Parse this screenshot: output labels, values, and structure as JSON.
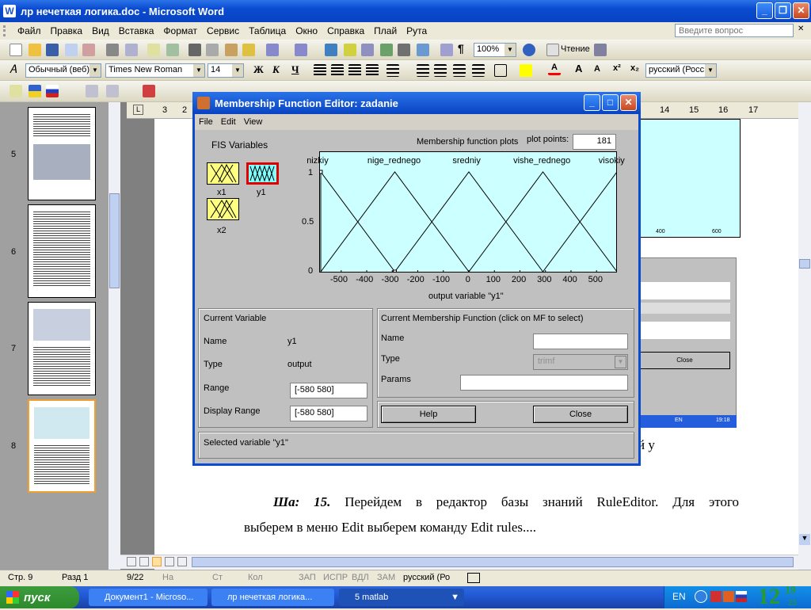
{
  "window": {
    "title": "лр нечеткая логика.doc - Microsoft Word",
    "app_icon": "W"
  },
  "menu": [
    "Файл",
    "Правка",
    "Вид",
    "Вставка",
    "Формат",
    "Сервис",
    "Таблица",
    "Окно",
    "Справка",
    "Плай",
    "Рута"
  ],
  "help_placeholder": "Введите вопрос",
  "toolbar": {
    "zoom": "100%",
    "read_label": "Чтение"
  },
  "format": {
    "style": "Обычный (веб)",
    "font": "Times New Roman",
    "size": "14",
    "bold": "Ж",
    "italic": "К",
    "underline": "Ч",
    "language": "русский (Росс"
  },
  "ruler": {
    "numbers": [
      "3",
      "2",
      "14",
      "15",
      "16",
      "17"
    ]
  },
  "thumbnails": [
    {
      "num": "5"
    },
    {
      "num": "6"
    },
    {
      "num": "7"
    },
    {
      "num": "8"
    }
  ],
  "document": {
    "partial_line": "й у",
    "step_label": "Ша: 15.",
    "step_text": "Перейдем в редактор базы знаний RuleEditor. Для этого",
    "step_text2": "выберем в меню Edit выберем команду Edit rules....",
    "bg_ticks": [
      "400",
      "600"
    ],
    "bg_close": "Close",
    "bg_tray_lang": "EN",
    "bg_tray_time": "19:18"
  },
  "dialog": {
    "title": "Membership Function Editor: zadanie",
    "menu": [
      "File",
      "Edit",
      "View"
    ],
    "fis_variables_label": "FIS Variables",
    "variables": [
      {
        "name": "x1"
      },
      {
        "name": "y1"
      },
      {
        "name": "x2"
      }
    ],
    "plot_title": "Membership function plots",
    "plot_points_label": "plot points:",
    "plot_points_value": "181",
    "chart_data": {
      "type": "line",
      "xlabel": "output variable \"y1\"",
      "xlim": [
        -580,
        580
      ],
      "ylim": [
        0,
        1
      ],
      "xticks": [
        "-500",
        "-400",
        "-300",
        "-200",
        "-100",
        "0",
        "100",
        "200",
        "300",
        "400",
        "500"
      ],
      "yticks": [
        "0",
        "0.5",
        "1"
      ],
      "series": [
        {
          "name": "nizkiy",
          "x": [
            -580,
            -580,
            -290
          ],
          "y": [
            0,
            1,
            0
          ]
        },
        {
          "name": "nige_rednego",
          "x": [
            -580,
            -290,
            0
          ],
          "y": [
            0,
            1,
            0
          ]
        },
        {
          "name": "sredniy",
          "x": [
            -290,
            0,
            290
          ],
          "y": [
            0,
            1,
            0
          ]
        },
        {
          "name": "vishe_rednego",
          "x": [
            0,
            290,
            580
          ],
          "y": [
            0,
            1,
            0
          ]
        },
        {
          "name": "visokiy",
          "x": [
            290,
            580,
            580
          ],
          "y": [
            0,
            1,
            0
          ]
        }
      ]
    },
    "current_variable": {
      "header": "Current Variable",
      "name_label": "Name",
      "name_value": "y1",
      "type_label": "Type",
      "type_value": "output",
      "range_label": "Range",
      "range_value": "[-580 580]",
      "display_range_label": "Display Range",
      "display_range_value": "[-580 580]"
    },
    "current_mf": {
      "header": "Current Membership Function (click on MF to select)",
      "name_label": "Name",
      "name_value": "",
      "type_label": "Type",
      "type_value": "trimf",
      "params_label": "Params",
      "params_value": ""
    },
    "help_button": "Help",
    "close_button": "Close",
    "status": "Selected variable \"y1\""
  },
  "status_bar": {
    "page": "Стр. 9",
    "section": "Разд 1",
    "count": "9/22",
    "at": "На",
    "line": "Ст",
    "col": "Кол",
    "rec": "ЗАП",
    "trk": "ИСПР",
    "ext": "ВДЛ",
    "ovr": "ЗАМ",
    "lang": "русский (Ро"
  },
  "taskbar": {
    "start": "пуск",
    "tasks": [
      "Документ1 - Microso...",
      "лр нечеткая логика...",
      "5 matlab"
    ],
    "lang": "EN",
    "time_hour": "12",
    "time_min": "19",
    "time_sec": "25"
  }
}
